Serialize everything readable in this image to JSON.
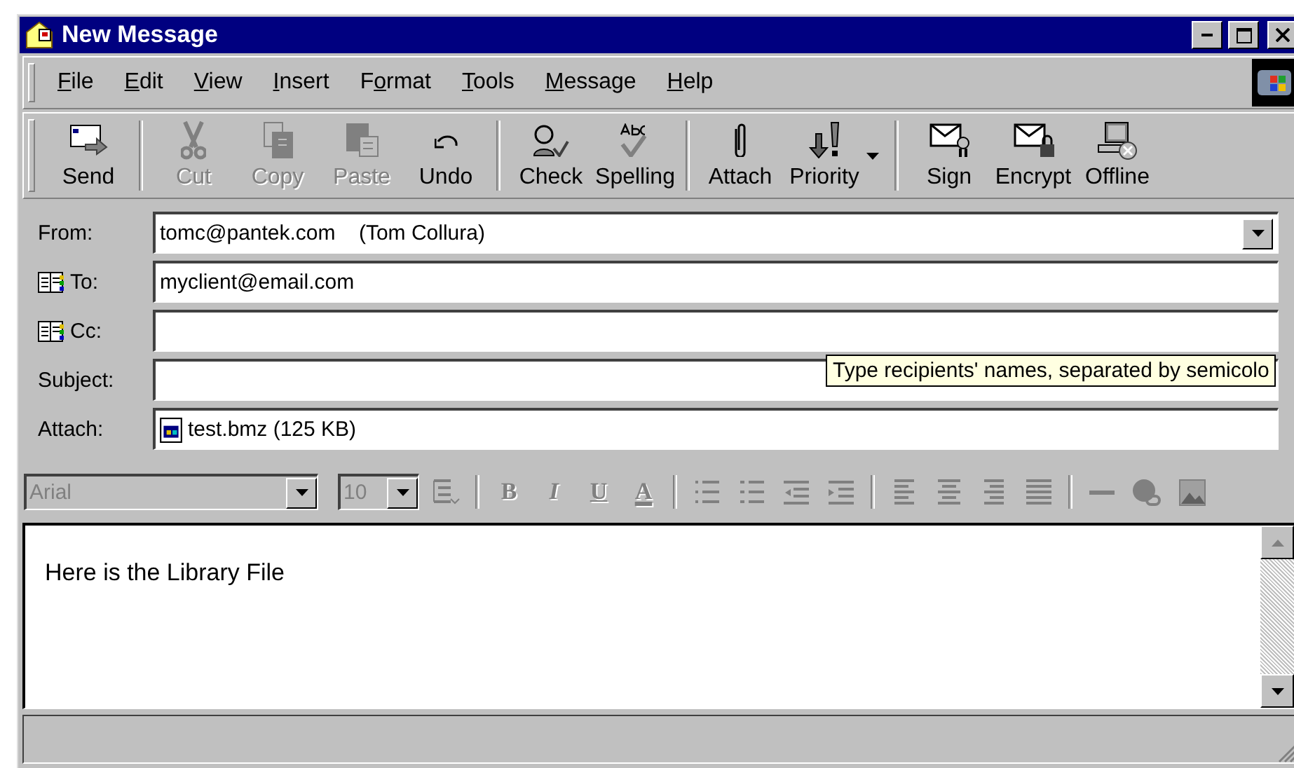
{
  "window": {
    "title": "New Message"
  },
  "menu": [
    {
      "label": "File"
    },
    {
      "label": "Edit"
    },
    {
      "label": "View"
    },
    {
      "label": "Insert"
    },
    {
      "label": "Format"
    },
    {
      "label": "Tools"
    },
    {
      "label": "Message"
    },
    {
      "label": "Help"
    }
  ],
  "toolbar_groups": [
    [
      {
        "label": "Send",
        "disabled": false,
        "kind": "plain"
      }
    ],
    [
      {
        "label": "Cut",
        "disabled": true,
        "kind": "plain"
      },
      {
        "label": "Copy",
        "disabled": true,
        "kind": "plain"
      },
      {
        "label": "Paste",
        "disabled": true,
        "kind": "plain"
      },
      {
        "label": "Undo",
        "disabled": false,
        "kind": "plain"
      }
    ],
    [
      {
        "label": "Check",
        "disabled": false,
        "kind": "plain"
      },
      {
        "label": "Spelling",
        "disabled": false,
        "kind": "plain"
      }
    ],
    [
      {
        "label": "Attach",
        "disabled": false,
        "kind": "plain"
      },
      {
        "label": "Priority",
        "disabled": false,
        "kind": "dropdown"
      }
    ],
    [
      {
        "label": "Sign",
        "disabled": false,
        "kind": "plain"
      },
      {
        "label": "Encrypt",
        "disabled": false,
        "kind": "plain"
      },
      {
        "label": "Offline",
        "disabled": false,
        "kind": "plain"
      }
    ]
  ],
  "fields": [
    {
      "label": "From:",
      "kind": "combo",
      "value": "tomc@pantek.com    (Tom Collura)"
    },
    {
      "label": "To:",
      "kind": "address",
      "value": "myclient@email.com"
    },
    {
      "label": "Cc:",
      "kind": "address"
    },
    {
      "label": "Subject:",
      "kind": "text"
    },
    {
      "label": "Attach:",
      "kind": "attachment",
      "value": "test.bmz (125 KB)"
    }
  ],
  "tooltip": "Type recipients' names, separated by semicolo",
  "format_bar": {
    "font": "Arial",
    "size": "10",
    "disabled": true,
    "glyphs": [
      "B",
      "I",
      "U",
      "A"
    ]
  },
  "body": {
    "text": "Here is the Library File"
  }
}
